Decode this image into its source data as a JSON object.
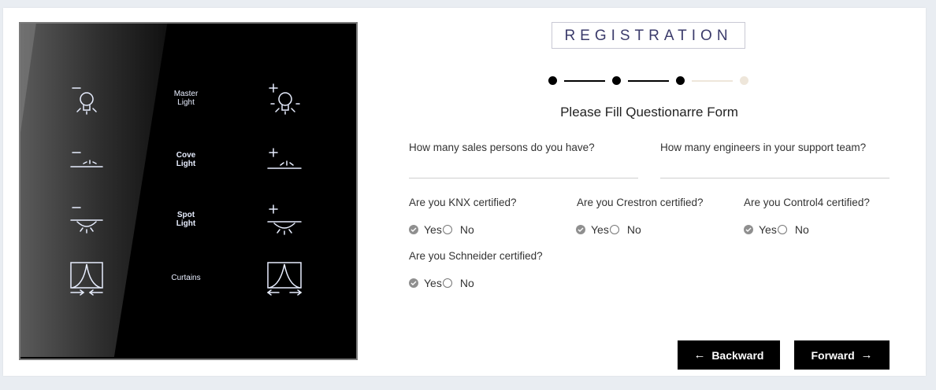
{
  "panel": {
    "row_labels": [
      "Master Light",
      "Cove Light",
      "Spot Light",
      "Curtains"
    ]
  },
  "form": {
    "title": "REGISTRATION",
    "stepper": {
      "total_steps": 4,
      "current_step": 3
    },
    "heading": "Please Fill Questionarre Form",
    "questions": {
      "sales_persons": {
        "label": "How many sales persons do you have?",
        "value": ""
      },
      "engineers": {
        "label": "How many engineers in your support team?",
        "value": ""
      },
      "knx": {
        "label": "Are you KNX certified?",
        "yes": "Yes",
        "no": "No",
        "selected": "Yes"
      },
      "crestron": {
        "label": "Are you Crestron certified?",
        "yes": "Yes",
        "no": "No",
        "selected": "Yes"
      },
      "control4": {
        "label": "Are you Control4 certified?",
        "yes": "Yes",
        "no": "No",
        "selected": "Yes"
      },
      "schneider": {
        "label": "Are you Schneider certified?",
        "yes": "Yes",
        "no": "No",
        "selected": "Yes"
      }
    },
    "buttons": {
      "backward": "Backward",
      "forward": "Forward"
    }
  },
  "colors": {
    "step_done": "#000000",
    "step_pending": "#eee6da",
    "title_text": "#3b3b6b",
    "button_bg": "#000000"
  }
}
